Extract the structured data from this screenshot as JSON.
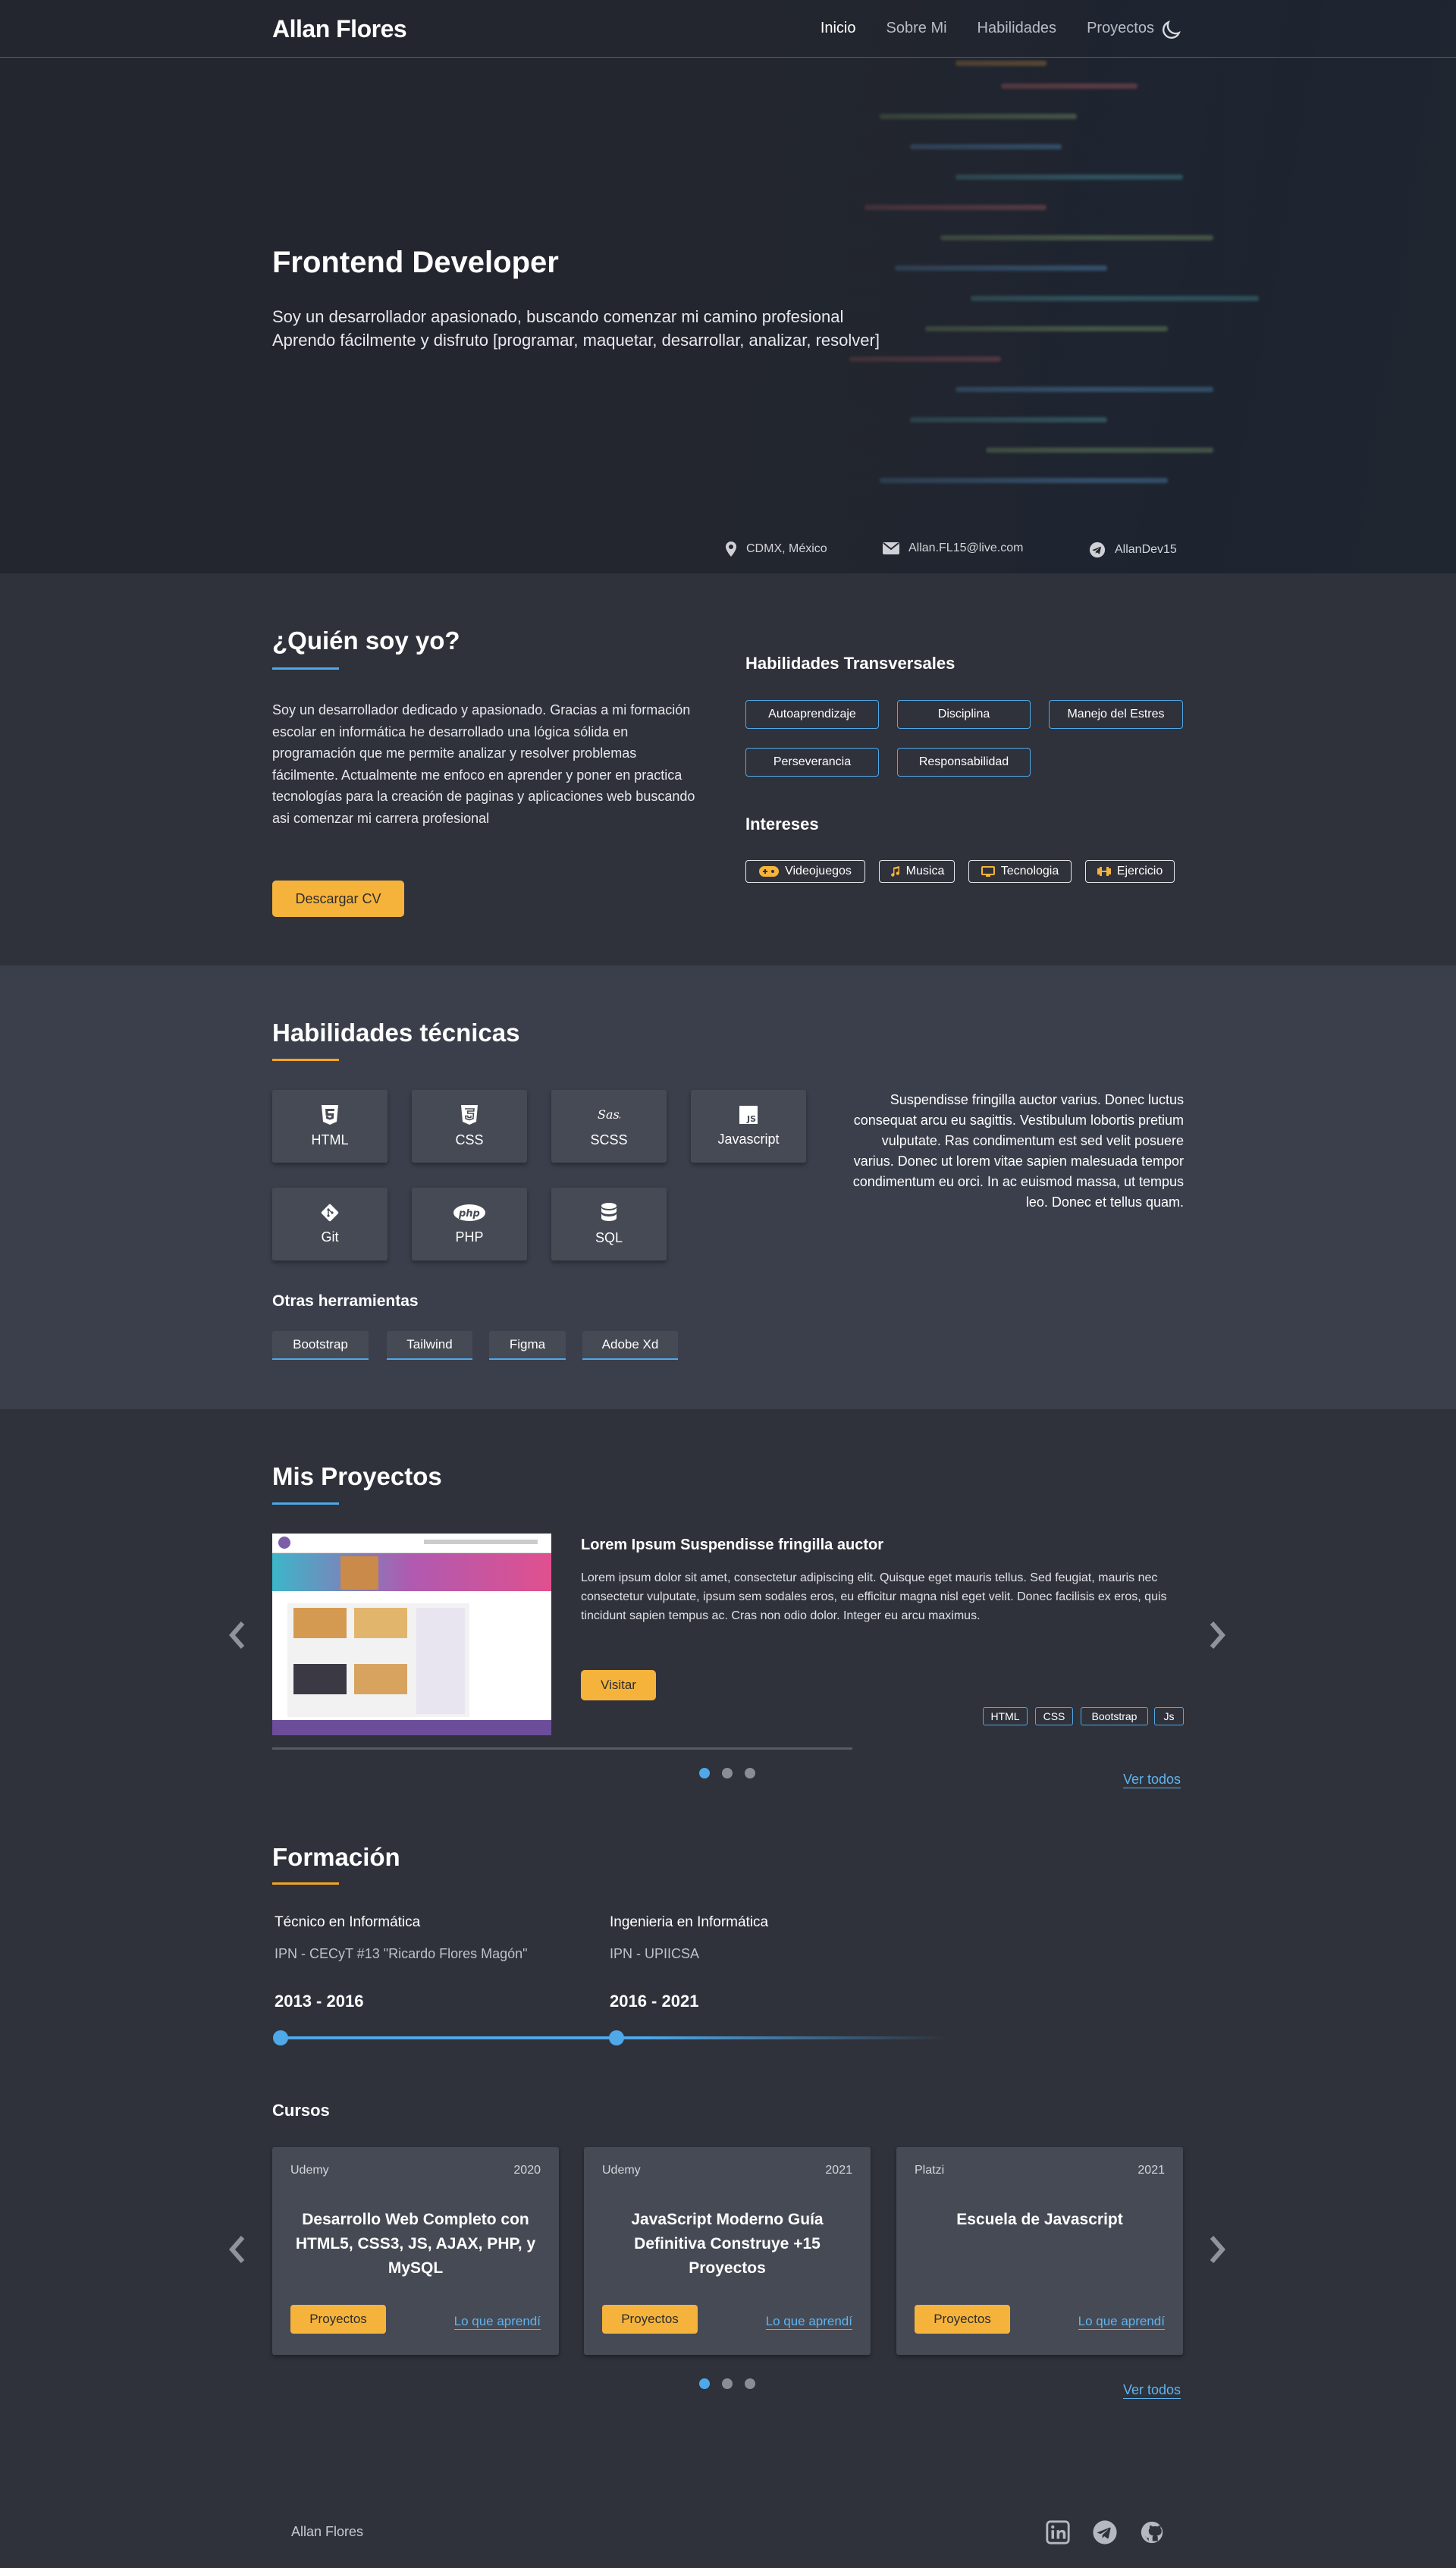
{
  "nav": {
    "brand": "Allan Flores",
    "links": [
      "Inicio",
      "Sobre Mi",
      "Habilidades",
      "Proyectos"
    ],
    "theme_icon": "moon-icon"
  },
  "hero": {
    "title": "Frontend Developer",
    "line1": "Soy un desarrollador apasionado, buscando comenzar mi camino profesional",
    "line2": "Aprendo fácilmente y disfruto [programar, maquetar, desarrollar, analizar, resolver]",
    "socials": [
      "linkedin-icon",
      "github-icon"
    ],
    "location": "CDMX, México",
    "email": "Allan.FL15@live.com",
    "telegram": "AllanDev15"
  },
  "about": {
    "title": "¿Quién soy yo?",
    "text": "Soy un desarrollador dedicado y apasionado. Gracias a mi formación escolar en informática he desarrollado una lógica sólida en programación que me permite analizar y resolver problemas fácilmente. Actualmente me enfoco en aprender y poner en practica tecnologías para la creación de paginas y aplicaciones web buscando asi comenzar mi carrera profesional",
    "cv_button": "Descargar CV",
    "soft_title": "Habilidades Transversales",
    "soft_skills": [
      "Autoaprendizaje",
      "Disciplina",
      "Manejo del Estres",
      "Perseverancia",
      "Responsabilidad"
    ],
    "interests_title": "Intereses",
    "interests": [
      "Videojuegos",
      "Musica",
      "Tecnologia",
      "Ejercicio"
    ],
    "accent": "#4fa8e8",
    "button_color": "#f6b33b"
  },
  "skills": {
    "title": "Habilidades técnicas",
    "items": [
      "HTML",
      "CSS",
      "SCSS",
      "Javascript",
      "Git",
      "PHP",
      "SQL"
    ],
    "icons": [
      "html5-icon",
      "css3-icon",
      "sass-icon",
      "js-icon",
      "git-icon",
      "php-icon",
      "database-icon"
    ],
    "text": "Suspendisse fringilla auctor varius. Donec luctus consequat arcu eu sagittis.  Vestibulum lobortis pretium vulputate. Ras condimentum est sed velit posuere varius. Donec ut lorem vitae sapien malesuada tempor condimentum eu orci. In ac euismod massa, ut tempus leo. Donec et tellus quam.",
    "tools_title": "Otras herramientas",
    "tools": [
      "Bootstrap",
      "Tailwind",
      "Figma",
      "Adobe Xd"
    ]
  },
  "projects": {
    "title": "Mis Proyectos",
    "item_title": "Lorem Ipsum Suspendisse fringilla auctor",
    "item_desc": "Lorem ipsum dolor sit amet, consectetur adipiscing elit. Quisque eget mauris tellus. Sed feugiat, mauris nec consectetur vulputate, ipsum sem sodales eros, eu efficitur magna nisl eget velit. Donec facilisis ex eros, quis tincidunt sapien tempus ac. Cras non odio dolor. Integer eu arcu maximus.",
    "visit": "Visitar",
    "tags": [
      "HTML",
      "CSS",
      "Bootstrap",
      "Js"
    ],
    "see_all": "Ver todos",
    "active_slide": 1,
    "slide_count": 3
  },
  "education": {
    "title": "Formación",
    "items": [
      {
        "degree": "Técnico en Informática",
        "school": "IPN - CECyT #13 \"Ricardo Flores Magón\"",
        "years": "2013 - 2016"
      },
      {
        "degree": "Ingenieria en Informática",
        "school": "IPN - UPIICSA",
        "years": "2016 - 2021"
      }
    ]
  },
  "courses": {
    "title": "Cursos",
    "items": [
      {
        "platform": "Udemy",
        "year": "2020",
        "name": "Desarrollo Web Completo con HTML5, CSS3, JS, AJAX, PHP, y MySQL"
      },
      {
        "platform": "Udemy",
        "year": "2021",
        "name": "JavaScript Moderno Guía Definitiva Construye +15 Proyectos"
      },
      {
        "platform": "Platzi",
        "year": "2021",
        "name": "Escuela de Javascript"
      }
    ],
    "projects_btn": "Proyectos",
    "learned_link": "Lo que aprendí",
    "see_all": "Ver todos"
  },
  "footer": {
    "name": "Allan Flores",
    "icons": [
      "linkedin-icon",
      "telegram-icon",
      "github-icon"
    ]
  }
}
